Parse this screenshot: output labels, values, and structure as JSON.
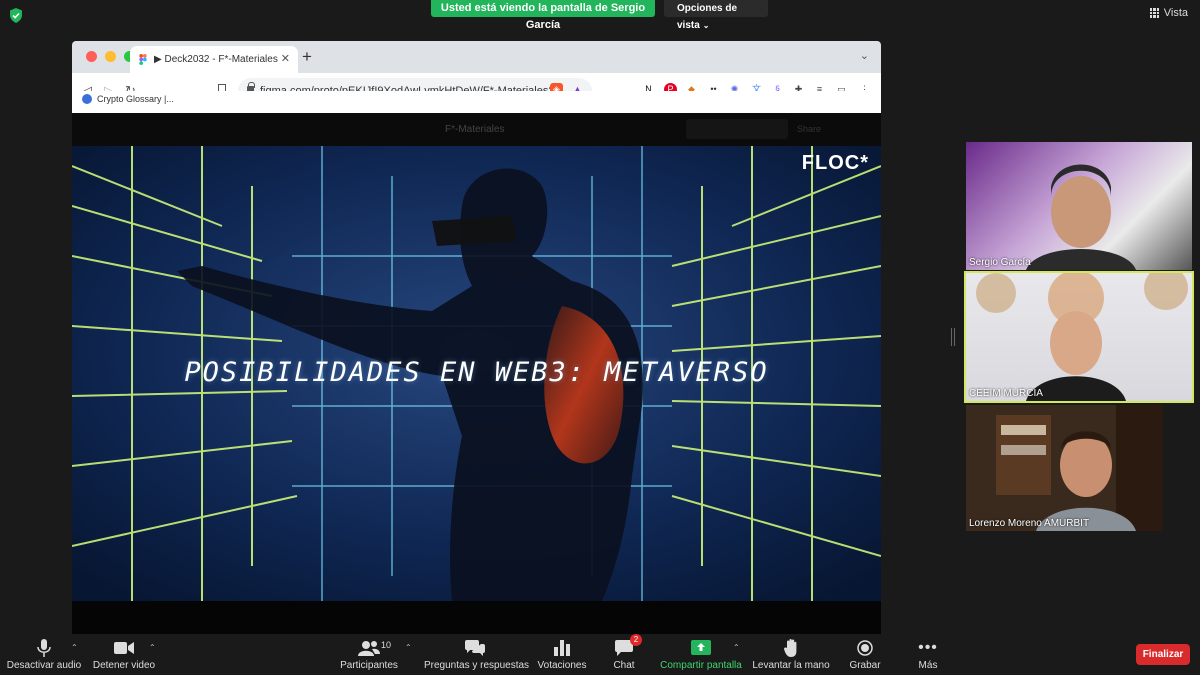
{
  "zoom": {
    "banner_text": "Usted está viendo la pantalla de Sergio García",
    "view_options_label": "Opciones de vista",
    "view_label": "Vista"
  },
  "browser": {
    "tab_title": "▶ Deck2032 - F*-Materiales",
    "url": "figma.com/proto/pEKIJfI9XodAwLvmkHtDeW/F*-Materiales?...",
    "bookmark_label": "Crypto Glossary |...",
    "figma_title": "F*-Materiales",
    "figma_right_btn": "Share"
  },
  "slide": {
    "title": "POSIBILIDADES EN WEB3: METAVERSO",
    "brand": "FLOC*"
  },
  "participants": [
    {
      "name": "Sergio García",
      "active": false
    },
    {
      "name": "CEEIM MURCIA",
      "active": true
    },
    {
      "name": "Lorenzo Moreno AMURBIT",
      "active": false
    }
  ],
  "controls": {
    "mute": "Desactivar audio",
    "video": "Detener video",
    "participants": "Participantes",
    "participants_count": "10",
    "qa": "Preguntas y respuestas",
    "polls": "Votaciones",
    "chat": "Chat",
    "chat_badge": "2",
    "share": "Compartir pantalla",
    "raise_hand": "Levantar la mano",
    "record": "Grabar",
    "more": "Más",
    "end": "Finalizar"
  },
  "colors": {
    "banner_green": "#23b55b",
    "active_border": "#d4e85d",
    "end_red": "#d92b2b"
  }
}
